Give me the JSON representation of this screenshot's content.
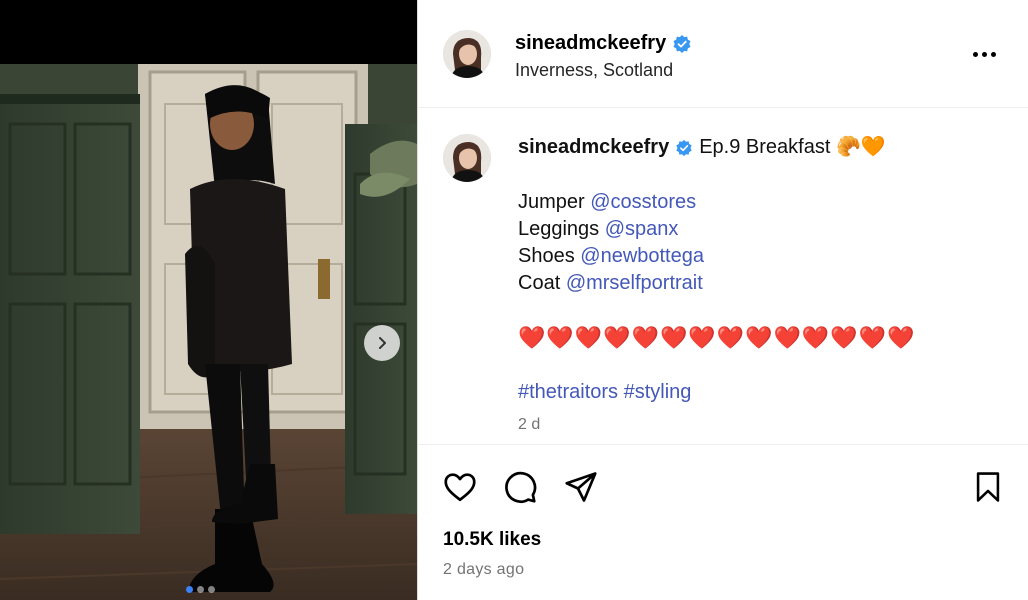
{
  "post": {
    "username": "sineadmckeefry",
    "location": "Inverness, Scotland",
    "caption": {
      "username": "sineadmckeefry",
      "title": "Ep.9 Breakfast 🥐🧡",
      "lines": [
        {
          "label": "Jumper ",
          "mention": "@cosstores"
        },
        {
          "label": "Leggings ",
          "mention": "@spanx"
        },
        {
          "label": "Shoes ",
          "mention": "@newbottega"
        },
        {
          "label": "Coat ",
          "mention": "@mrselfportrait"
        }
      ],
      "hearts": "❤️❤️❤️❤️❤️❤️❤️❤️❤️❤️❤️❤️❤️❤️",
      "hashtags": "#thetraitors #styling",
      "age": "2 d"
    },
    "likes": "10.5K likes",
    "posted": "2 days ago",
    "carousel": {
      "count": 3,
      "active": 0
    }
  },
  "colors": {
    "verified": "#3897f0",
    "mention": "#4458b8",
    "heart": "#d11a2a",
    "muted": "#737373"
  },
  "icons": {
    "like": "heart-icon",
    "comment": "comment-icon",
    "share": "send-icon",
    "save": "bookmark-icon",
    "next": "chevron-right-icon",
    "more": "more-horizontal-icon",
    "verified": "verified-badge-icon"
  }
}
